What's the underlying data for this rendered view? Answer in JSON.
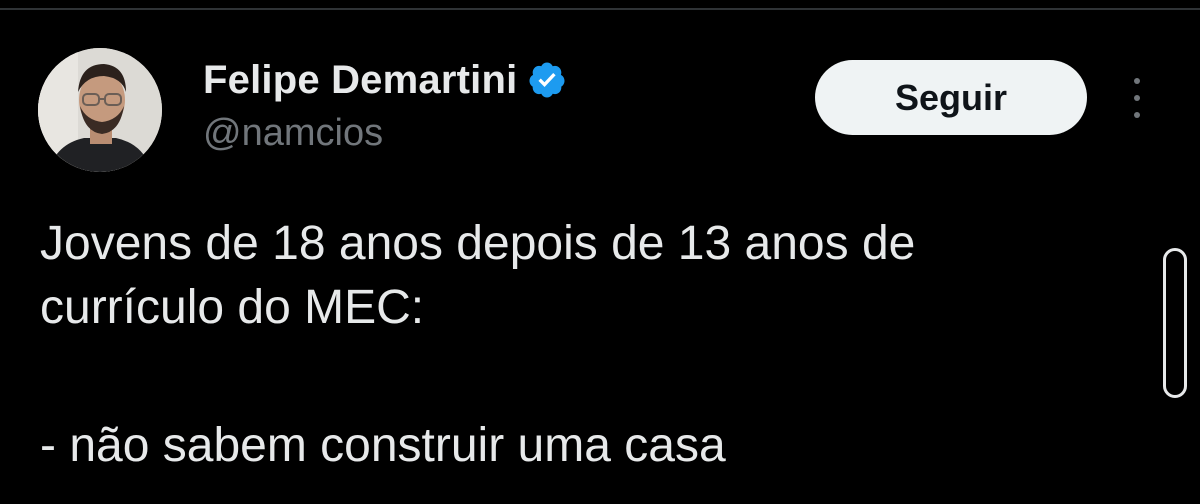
{
  "author": {
    "display_name": "Felipe Demartini",
    "handle": "@namcios",
    "verified_color": "#1d9bf0"
  },
  "actions": {
    "follow_label": "Seguir",
    "more_icon": "ellipsis-vertical-icon"
  },
  "tweet": {
    "lines": [
      "Jovens de 18 anos depois de 13 anos de",
      "currículo do MEC:",
      "",
      "- não sabem construir uma casa"
    ]
  },
  "colors": {
    "background": "#000000",
    "text_primary": "#e7e9ea",
    "text_secondary": "#71767b",
    "button_bg": "#eff3f4",
    "button_text": "#0f1419"
  }
}
